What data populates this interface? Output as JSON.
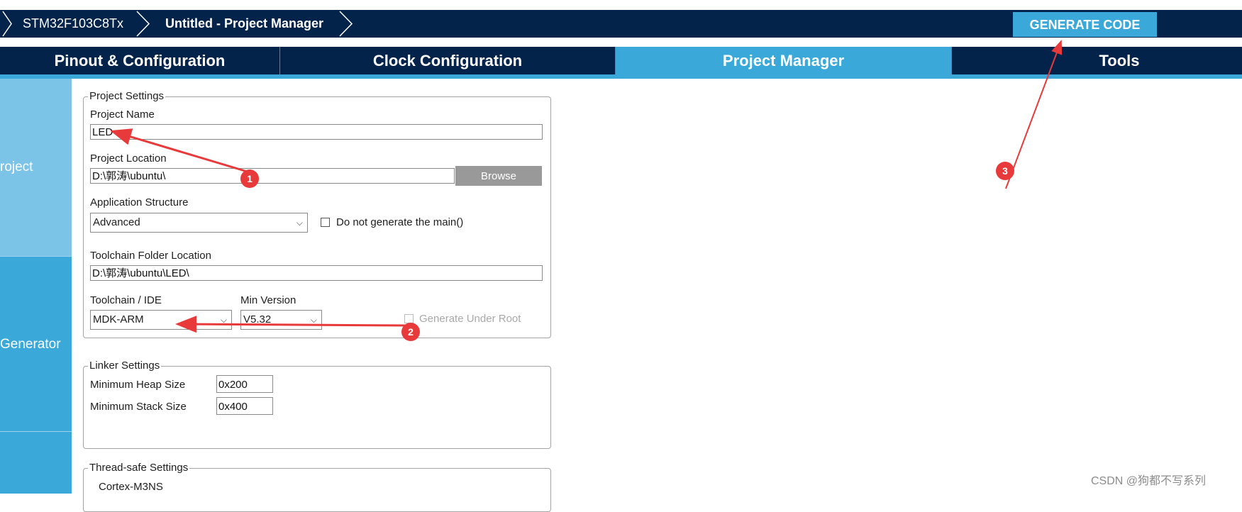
{
  "breadcrumb": {
    "mcu": "STM32F103C8Tx",
    "project": "Untitled - Project Manager"
  },
  "toolbar": {
    "generate_label": "GENERATE CODE"
  },
  "tabs": [
    {
      "label": "Pinout & Configuration"
    },
    {
      "label": "Clock Configuration"
    },
    {
      "label": "Project Manager"
    },
    {
      "label": "Tools"
    }
  ],
  "sidebar": {
    "items": [
      {
        "label": "roject"
      },
      {
        "label": "Generator"
      }
    ]
  },
  "project_settings": {
    "legend": "Project Settings",
    "name_label": "Project Name",
    "name_value": "LED",
    "location_label": "Project Location",
    "location_value": "D:\\郭涛\\ubuntu\\",
    "browse_label": "Browse",
    "app_structure_label": "Application Structure",
    "app_structure_value": "Advanced",
    "no_main_label": "Do not generate the main()",
    "toolchain_folder_label": "Toolchain Folder Location",
    "toolchain_folder_value": "D:\\郭涛\\ubuntu\\LED\\",
    "toolchain_label": "Toolchain / IDE",
    "toolchain_value": "MDK-ARM",
    "min_version_label": "Min Version",
    "min_version_value": "V5.32",
    "gen_under_root_label": "Generate Under Root"
  },
  "linker_settings": {
    "legend": "Linker Settings",
    "heap_label": "Minimum Heap Size",
    "heap_value": "0x200",
    "stack_label": "Minimum Stack Size",
    "stack_value": "0x400"
  },
  "thread_safe": {
    "legend": "Thread-safe Settings",
    "core": "Cortex-M3NS"
  },
  "annotations": {
    "badge1": "1",
    "badge2": "2",
    "badge3": "3",
    "color": "#e83a3a"
  },
  "watermark": "CSDN @狗都不写系列"
}
